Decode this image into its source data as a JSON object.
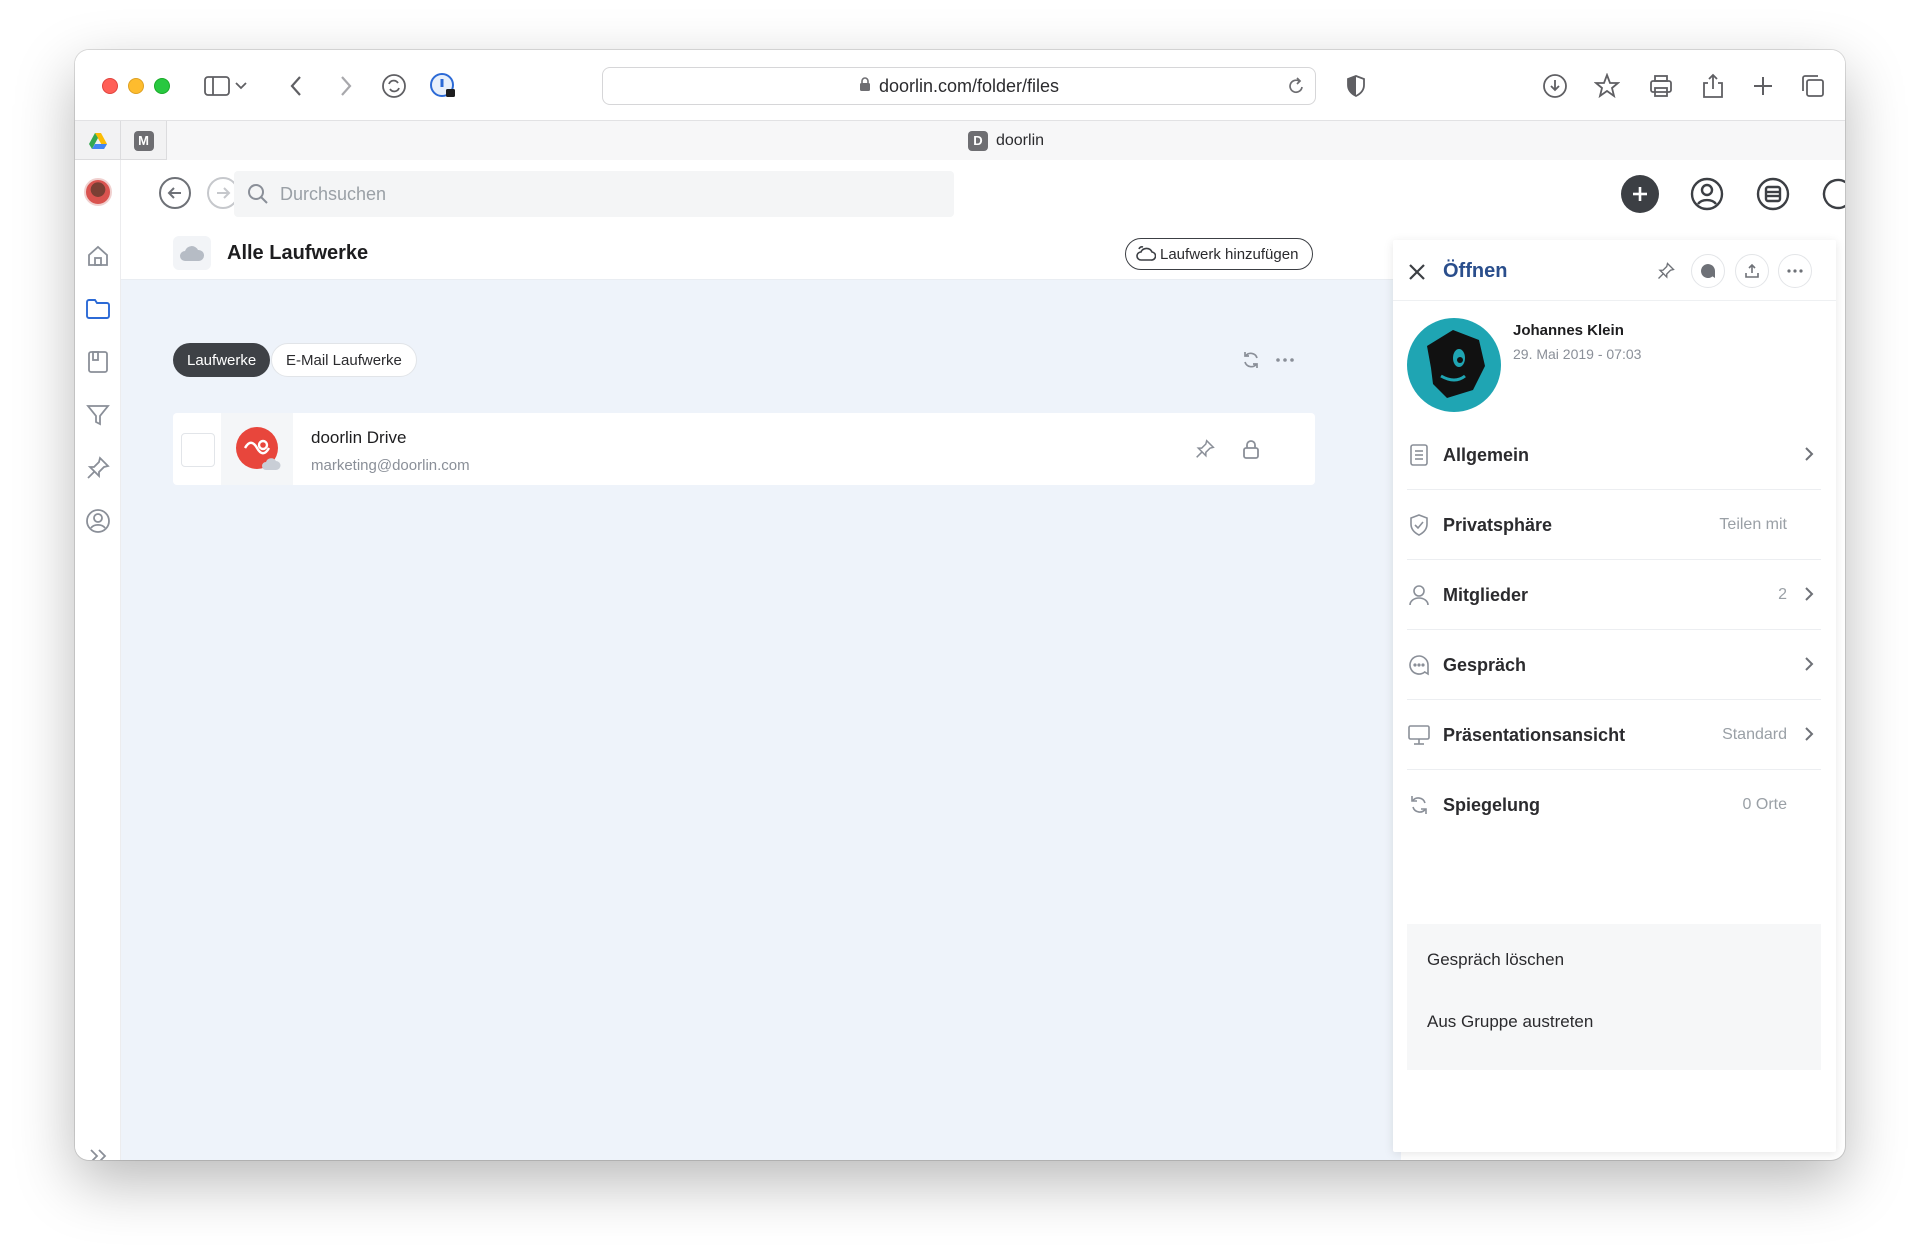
{
  "browser": {
    "url": "doorlin.com/folder/files",
    "tab_title": "doorlin",
    "tab_favicon_letter": "D",
    "pinned_tab_letter": "M"
  },
  "app": {
    "search_placeholder": "Durchsuchen",
    "page_title": "Alle Laufwerke",
    "add_drive_label": "Laufwerk hinzufügen",
    "filters": [
      "Laufwerke",
      "E-Mail Laufwerke"
    ],
    "active_filter": "Laufwerke",
    "drives": [
      {
        "name": "doorlin Drive",
        "email": "marketing@doorlin.com"
      }
    ]
  },
  "panel": {
    "title": "Öffnen",
    "owner_name": "Johannes Klein",
    "owner_date": "29. Mai 2019 - 07:03",
    "rows": [
      {
        "label": "Allgemein",
        "value": "",
        "icon": "document-icon",
        "chevron": true
      },
      {
        "label": "Privatsphäre",
        "value": "Teilen mit",
        "icon": "shield-icon",
        "chevron": false
      },
      {
        "label": "Mitglieder",
        "value": "2",
        "icon": "person-icon",
        "chevron": true
      },
      {
        "label": "Gespräch",
        "value": "",
        "icon": "chat-bubble-icon",
        "chevron": true
      },
      {
        "label": "Präsentationsansicht",
        "value": "Standard",
        "icon": "monitor-icon",
        "chevron": true
      },
      {
        "label": "Spiegelung",
        "value": "0 Orte",
        "icon": "sync-icon",
        "chevron": false
      }
    ],
    "actions": [
      "Gespräch löschen",
      "Aus Gruppe austreten"
    ]
  },
  "colors": {
    "panel_title": "#2a4e8c",
    "content_bg": "#eef3fa",
    "active_pill": "#3e4146",
    "drive_logo": "#e8463c",
    "owner_avatar": "#1fa5b3"
  }
}
